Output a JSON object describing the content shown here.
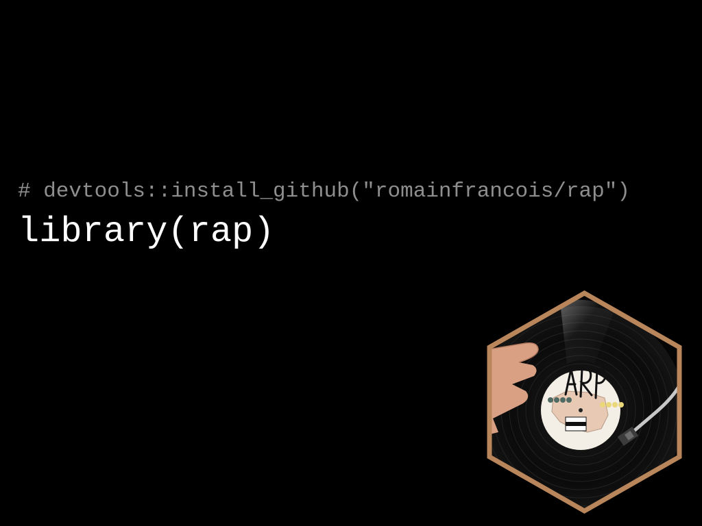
{
  "slide": {
    "background": "#000000",
    "comment_line": "# devtools::install_github(\"romainfrancois/rap\")",
    "code_line": "library(rap)",
    "comment_color": "#8e8e8e",
    "code_color": "#ffffff"
  },
  "sticker": {
    "name": "rap hex sticker",
    "border_color": "#b8865a",
    "logo_text": "RAP",
    "advisory_text": "PARENTAL ADVISORY"
  }
}
